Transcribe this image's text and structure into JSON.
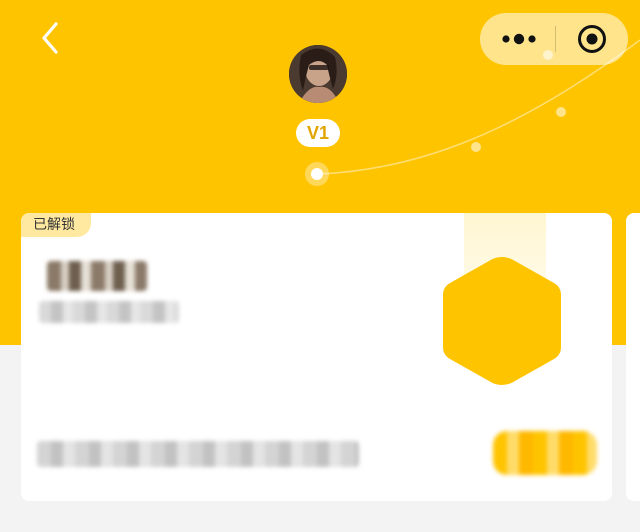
{
  "header": {
    "level_label": "V1",
    "theme_color": "#ffc400"
  },
  "icons": {
    "back": "chevron-left-icon",
    "more": "more-dots-icon",
    "close": "target-circle-icon"
  },
  "card": {
    "status_tag": "已解锁",
    "tag_color": "#ffe9a0",
    "badge_color": "#ffc400"
  }
}
